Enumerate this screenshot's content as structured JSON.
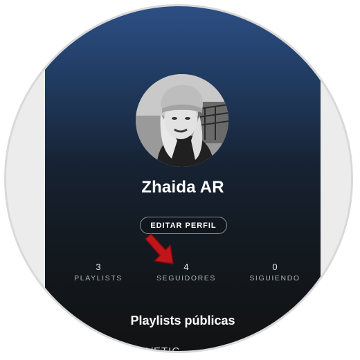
{
  "profile": {
    "name": "Zhaida AR",
    "edit_button": "EDITAR PERFIL"
  },
  "stats": {
    "playlists": {
      "count": "3",
      "label": "PLAYLISTS"
    },
    "followers": {
      "count": "4",
      "label": "SEGUIDORES"
    },
    "following": {
      "count": "0",
      "label": "SIGUIENDO"
    }
  },
  "sections": {
    "public_playlists_title": "Playlists públicas",
    "first_item_partial": "VETIC"
  },
  "colors": {
    "gradient_top": "#2c4f84",
    "background_bottom": "#121212",
    "arrow": "#c0161a",
    "text_primary": "#ffffff",
    "text_secondary": "#b3b3b3"
  },
  "icons": {
    "pointer": "red-arrow-icon"
  }
}
